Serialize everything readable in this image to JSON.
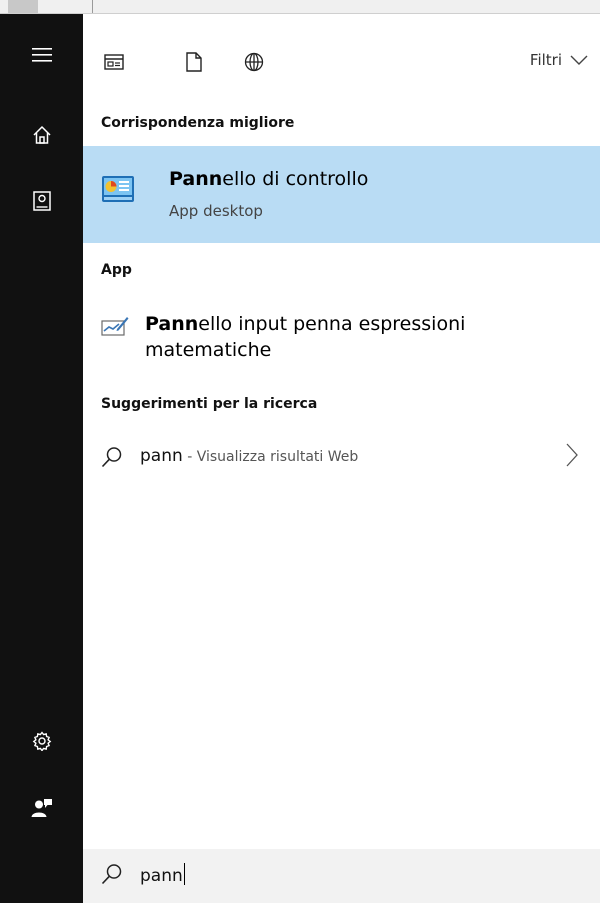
{
  "toolbar": {
    "tabs": [
      {
        "icon": "app-window-icon"
      },
      {
        "icon": "document-icon"
      },
      {
        "icon": "globe-icon"
      }
    ],
    "filter_label": "Filtri"
  },
  "rail": {
    "items": [
      "hamburger-menu-icon",
      "home-icon",
      "notebook-icon",
      "settings-gear-icon",
      "user-feedback-icon"
    ]
  },
  "best_match": {
    "heading": "Corrispondenza migliore",
    "title_bold": "Pann",
    "title_rest": "ello di controllo",
    "subtitle": "App desktop",
    "icon": "control-panel-icon",
    "highlight_color": "#b9dcf4"
  },
  "apps": {
    "heading": "App",
    "items": [
      {
        "title_bold": "Pann",
        "title_rest": "ello input penna espressioni matematiche",
        "icon": "math-input-panel-icon"
      }
    ]
  },
  "suggestions": {
    "heading": "Suggerimenti per la ricerca",
    "items": [
      {
        "query": "pann",
        "separator": " - ",
        "web_label": "Visualizza risultati Web"
      }
    ]
  },
  "search": {
    "value": "pann"
  }
}
